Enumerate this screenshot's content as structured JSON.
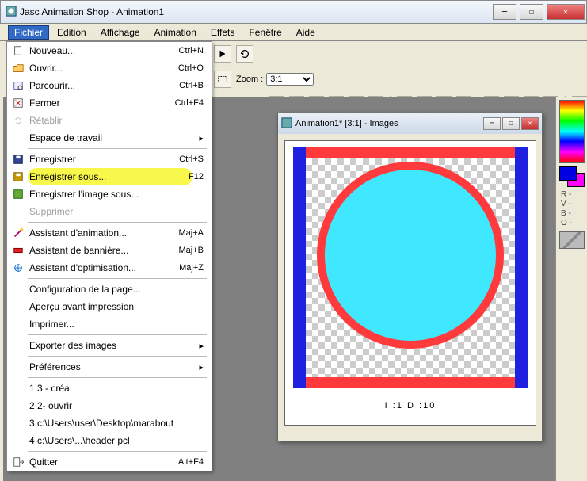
{
  "app": {
    "title": "Jasc Animation Shop - Animation1"
  },
  "menubar": {
    "fichier": "Fichier",
    "edition": "Edition",
    "affichage": "Affichage",
    "animation": "Animation",
    "effets": "Effets",
    "fenetre": "Fenêtre",
    "aide": "Aide"
  },
  "menu": {
    "nouveau": {
      "label": "Nouveau...",
      "shortcut": "Ctrl+N"
    },
    "ouvrir": {
      "label": "Ouvrir...",
      "shortcut": "Ctrl+O"
    },
    "parcourir": {
      "label": "Parcourir...",
      "shortcut": "Ctrl+B"
    },
    "fermer": {
      "label": "Fermer",
      "shortcut": "Ctrl+F4"
    },
    "retablir": {
      "label": "Rétablir"
    },
    "workspace": {
      "label": "Espace de travail"
    },
    "enreg": {
      "label": "Enregistrer",
      "shortcut": "Ctrl+S"
    },
    "enreg_sous": {
      "label": "Enregistrer sous...",
      "shortcut": "F12"
    },
    "enreg_img": {
      "label": "Enregistrer l'image sous..."
    },
    "supprimer": {
      "label": "Supprimer"
    },
    "assist_anim": {
      "label": "Assistant d'animation...",
      "shortcut": "Maj+A"
    },
    "assist_ban": {
      "label": "Assistant de bannière...",
      "shortcut": "Maj+B"
    },
    "assist_opt": {
      "label": "Assistant d'optimisation...",
      "shortcut": "Maj+Z"
    },
    "config_page": {
      "label": "Configuration de la page..."
    },
    "apercu": {
      "label": "Aperçu avant impression"
    },
    "imprimer": {
      "label": "Imprimer..."
    },
    "exporter": {
      "label": "Exporter des images"
    },
    "prefs": {
      "label": "Préférences"
    },
    "recent1": {
      "label": "1 3 - créa"
    },
    "recent2": {
      "label": "2 2- ouvrir"
    },
    "recent3": {
      "label": "3 c:\\Users\\user\\Desktop\\marabout"
    },
    "recent4": {
      "label": "4 c:\\Users\\...\\header pcl"
    },
    "quitter": {
      "label": "Quitter",
      "shortcut": "Alt+F4"
    }
  },
  "toolbar": {
    "zoom_label": "Zoom :",
    "zoom_value": "3:1"
  },
  "child": {
    "title": "Animation1* [3:1] - Images",
    "status": "I :1   D :10"
  },
  "readout": {
    "r": "R -",
    "v": "V -",
    "b": "B -",
    "o": "O -"
  }
}
